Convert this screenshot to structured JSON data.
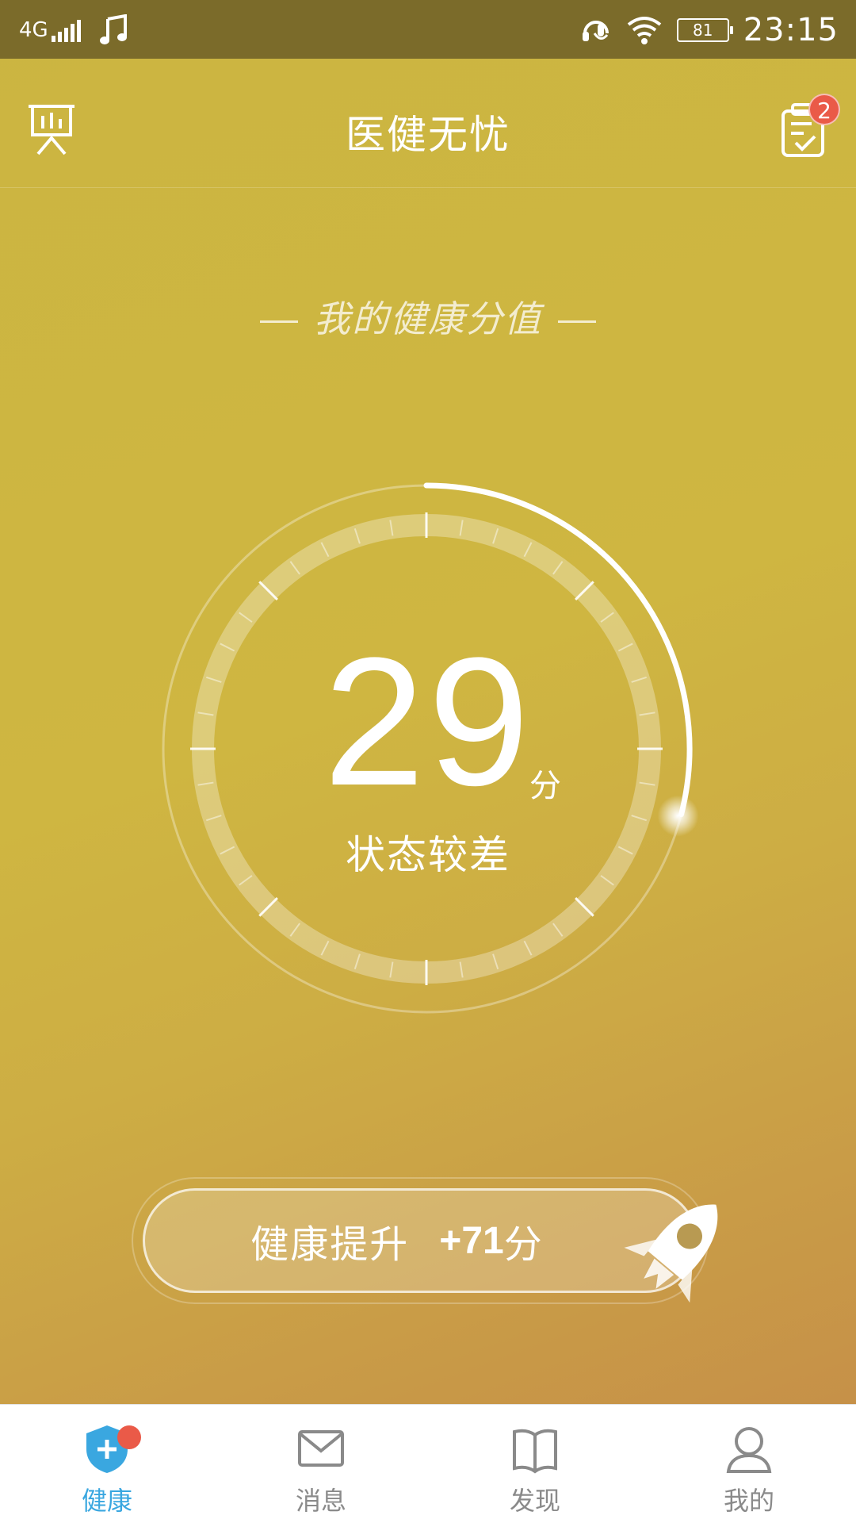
{
  "status_bar": {
    "network": "4G",
    "battery": "81",
    "time": "23:15",
    "icons": [
      "signal-icon",
      "music-note-icon",
      "headset-icon",
      "wifi-icon",
      "battery-icon"
    ]
  },
  "header": {
    "title": "医健无忧",
    "left_icon": "presentation-board-icon",
    "right_icon": "checklist-icon",
    "badge_count": "2"
  },
  "score_card": {
    "subtitle": "我的健康分值",
    "score": "29",
    "unit": "分",
    "status": "状态较差",
    "progress_fraction": 0.29
  },
  "improve_button": {
    "label": "健康提升",
    "points": "+71",
    "unit": "分",
    "icon": "rocket-icon"
  },
  "tab_bar": {
    "tabs": [
      {
        "label": "健康",
        "icon": "health-shield-icon",
        "active": true
      },
      {
        "label": "消息",
        "icon": "mail-icon",
        "active": false
      },
      {
        "label": "发现",
        "icon": "book-icon",
        "active": false
      },
      {
        "label": "我的",
        "icon": "user-icon",
        "active": false
      }
    ]
  },
  "colors": {
    "status_bar": "#7b6b2a",
    "background_top": "#cbb541",
    "background_bottom": "#c58b48",
    "badge": "#ea5a48",
    "tab_active": "#3aa7e0",
    "tab_inactive": "#8a8a8a"
  }
}
